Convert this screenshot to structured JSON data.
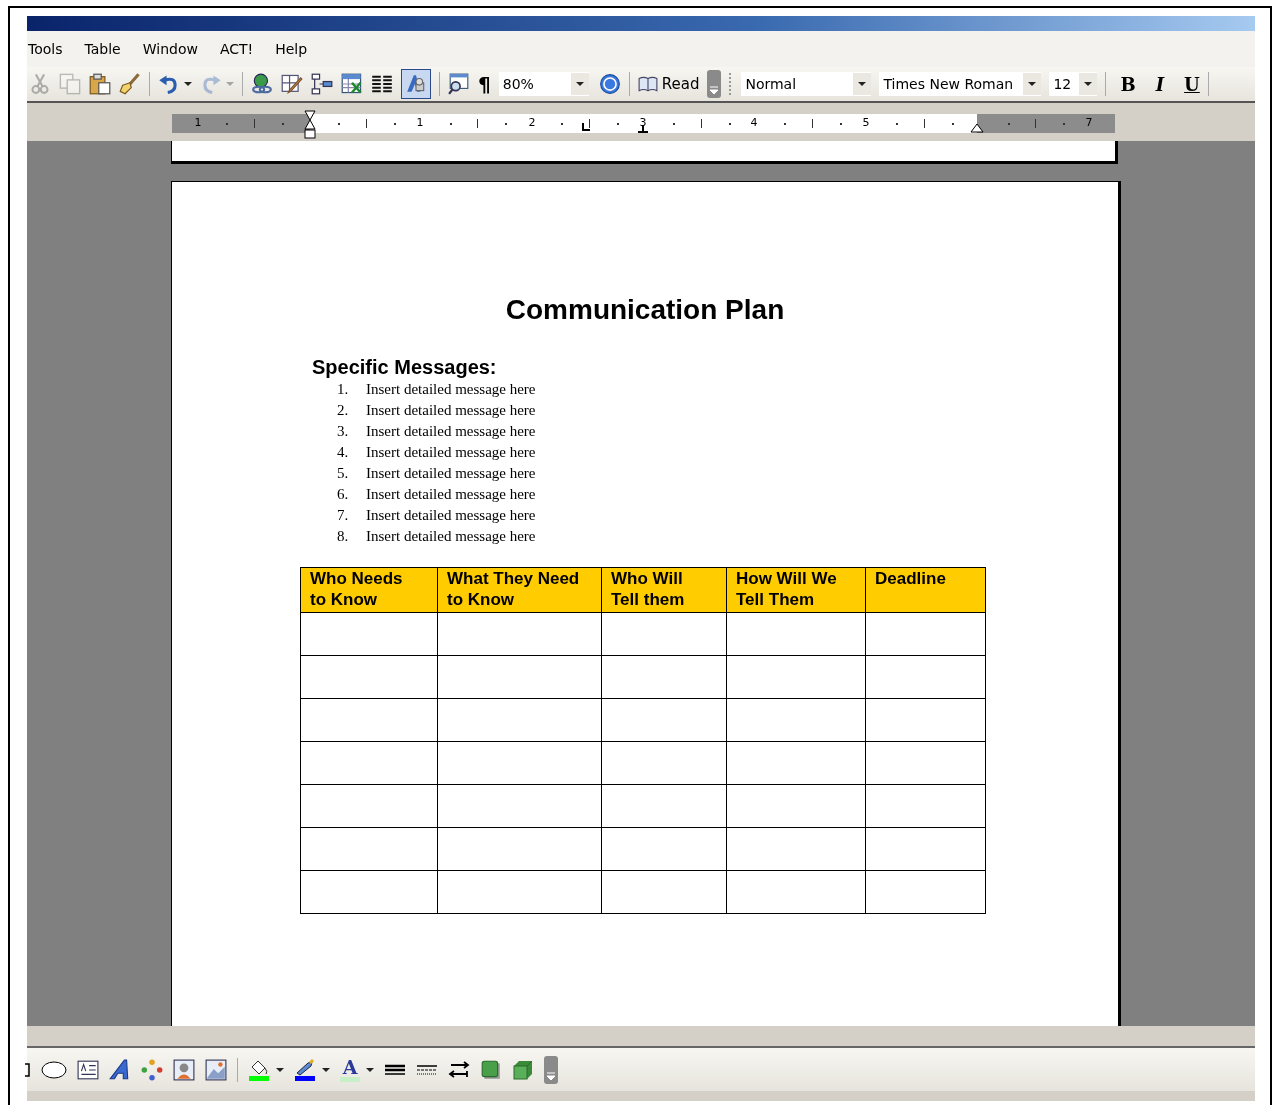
{
  "menu_bar": {
    "items": [
      "Tools",
      "Table",
      "Window",
      "ACT!",
      "Help"
    ]
  },
  "toolbar": {
    "tools": [
      {
        "kind": "cut",
        "disabled": true
      },
      {
        "kind": "copy",
        "disabled": true
      },
      {
        "kind": "paste",
        "disabled": false
      },
      {
        "kind": "format-painter",
        "disabled": false
      },
      {
        "kind": "separator"
      },
      {
        "kind": "undo",
        "disabled": false
      },
      {
        "kind": "dropdown",
        "disabled": false
      },
      {
        "kind": "redo",
        "disabled": true
      },
      {
        "kind": "dropdown",
        "disabled": true
      },
      {
        "kind": "separator"
      },
      {
        "kind": "hyperlink",
        "disabled": false
      },
      {
        "kind": "table-pencil",
        "disabled": false
      },
      {
        "kind": "insert-rows",
        "disabled": false
      },
      {
        "kind": "spreadsheet",
        "disabled": false
      },
      {
        "kind": "columns",
        "disabled": false
      },
      {
        "kind": "drawing"
      },
      {
        "kind": "separator"
      },
      {
        "kind": "document-map",
        "disabled": false
      }
    ],
    "pilcrow": "¶",
    "zoom": "80%",
    "read": "Read",
    "style": "Normal",
    "font": "Times New Roman",
    "size": "12",
    "bold": "B",
    "italic": "I",
    "underline": "U",
    "drawing_pressed": true
  },
  "ruler": {
    "labels": [
      "1",
      "1",
      "2",
      "3",
      "4",
      "5",
      "7"
    ]
  },
  "document": {
    "title": "Communication Plan",
    "heading": "Specific Messages:",
    "list": [
      {
        "number": "1.",
        "text": "Insert detailed message here"
      },
      {
        "number": "2.",
        "text": "Insert detailed message here"
      },
      {
        "number": "3.",
        "text": "Insert detailed message here"
      },
      {
        "number": "4.",
        "text": "Insert detailed message here"
      },
      {
        "number": "5.",
        "text": "Insert detailed message here"
      },
      {
        "number": "6.",
        "text": "Insert detailed message here"
      },
      {
        "number": "7.",
        "text": "Insert detailed message here"
      },
      {
        "number": "8.",
        "text": "Insert detailed message here"
      }
    ],
    "table": {
      "columns": [
        [
          "Who Needs",
          "to Know"
        ],
        [
          "What They Need",
          "to Know"
        ],
        [
          "Who Will",
          "Tell them"
        ],
        [
          "How Will We",
          "Tell Them"
        ],
        [
          "Deadline"
        ]
      ]
    }
  },
  "drawing_toolbar": {
    "font_color_glyph": "A"
  }
}
